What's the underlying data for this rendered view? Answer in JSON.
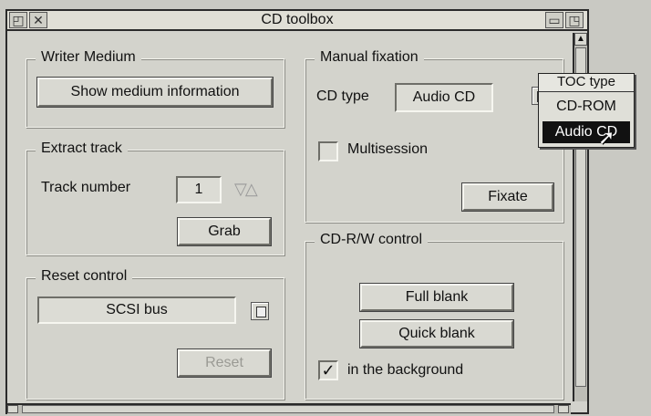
{
  "window": {
    "title": "CD toolbox"
  },
  "writer_medium": {
    "legend": "Writer Medium",
    "show_info_label": "Show medium information"
  },
  "extract_track": {
    "legend": "Extract track",
    "track_number_label": "Track number",
    "track_number_value": "1",
    "spinner_glyph": "▽△",
    "grab_label": "Grab"
  },
  "reset_control": {
    "legend": "Reset control",
    "bus_value": "SCSI bus",
    "reset_label": "Reset"
  },
  "manual_fixation": {
    "legend": "Manual fixation",
    "cd_type_label": "CD type",
    "cd_type_value": "Audio CD",
    "multisession_label": "Multisession",
    "multisession_checked": false,
    "fixate_label": "Fixate"
  },
  "cdrw_control": {
    "legend": "CD-R/W control",
    "full_blank_label": "Full blank",
    "quick_blank_label": "Quick blank",
    "background_label": "in the background",
    "background_checked": true,
    "check_glyph": "✓"
  },
  "toc_menu": {
    "title": "TOC type",
    "items": [
      {
        "label": "CD-ROM",
        "selected": false
      },
      {
        "label": "Audio CD",
        "selected": true
      }
    ]
  }
}
